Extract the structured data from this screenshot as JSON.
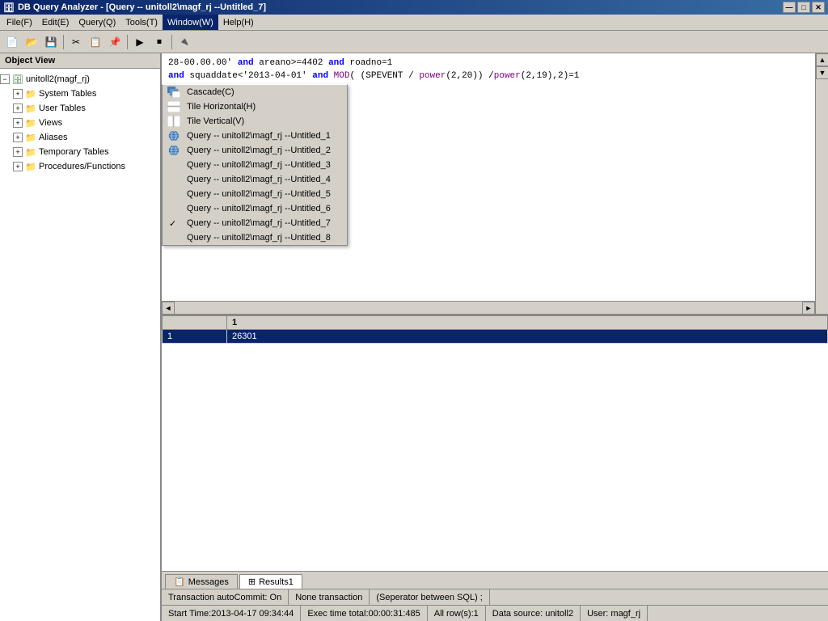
{
  "titleBar": {
    "title": "DB Query Analyzer - [Query -- unitoll2\\magf_rj --Untitled_7]",
    "dbIcon": "🗄",
    "controls": [
      "—",
      "□",
      "✕"
    ],
    "innerControls": [
      "—",
      "□",
      "✕"
    ]
  },
  "menuBar": {
    "items": [
      {
        "label": "File(F)",
        "id": "file"
      },
      {
        "label": "Edit(E)",
        "id": "edit"
      },
      {
        "label": "Query(Q)",
        "id": "query"
      },
      {
        "label": "Tools(T)",
        "id": "tools"
      },
      {
        "label": "Window(W)",
        "id": "window",
        "active": true
      },
      {
        "label": "Help(H)",
        "id": "help"
      }
    ]
  },
  "windowMenu": {
    "items": [
      {
        "label": "Cascade(C)",
        "hasIcon": true,
        "iconType": "cascade"
      },
      {
        "label": "Tile Horizontal(H)",
        "hasIcon": true,
        "iconType": "tile-h"
      },
      {
        "label": "Tile Vertical(V)",
        "hasIcon": true,
        "iconType": "tile-v"
      },
      {
        "label": "Query -- unitoll2\\magf_rj --Untitled_1",
        "hasIcon": true,
        "iconType": "globe"
      },
      {
        "label": "Query -- unitoll2\\magf_rj --Untitled_2",
        "hasIcon": true,
        "iconType": "globe"
      },
      {
        "label": "Query -- unitoll2\\magf_rj --Untitled_3",
        "hasIcon": false
      },
      {
        "label": "Query -- unitoll2\\magf_rj --Untitled_4",
        "hasIcon": false
      },
      {
        "label": "Query -- unitoll2\\magf_rj --Untitled_5",
        "hasIcon": false
      },
      {
        "label": "Query -- unitoll2\\magf_rj --Untitled_6",
        "hasIcon": false
      },
      {
        "label": "Query -- unitoll2\\magf_rj --Untitled_7",
        "hasIcon": false,
        "checked": true
      },
      {
        "label": "Query -- unitoll2\\magf_rj --Untitled_8",
        "hasIcon": false
      }
    ]
  },
  "objectView": {
    "header": "Object View",
    "tree": [
      {
        "level": 0,
        "label": "unitoll2(magf_rj)",
        "icon": "db",
        "expanded": true,
        "toggle": "-"
      },
      {
        "level": 1,
        "label": "System Tables",
        "icon": "folder",
        "expanded": false,
        "toggle": "+"
      },
      {
        "level": 1,
        "label": "User Tables",
        "icon": "folder",
        "expanded": false,
        "toggle": "+"
      },
      {
        "level": 1,
        "label": "Views",
        "icon": "folder",
        "expanded": false,
        "toggle": "+"
      },
      {
        "level": 1,
        "label": "Aliases",
        "icon": "folder",
        "expanded": false,
        "toggle": "+"
      },
      {
        "level": 1,
        "label": "Temporary Tables",
        "icon": "folder",
        "expanded": false,
        "toggle": "+"
      },
      {
        "level": 1,
        "label": "Procedures/Functions",
        "icon": "folder",
        "expanded": false,
        "toggle": "+"
      }
    ]
  },
  "sqlEditor": {
    "line1": "28-00.00.00' and areano>=4402 and roadno=1",
    "line2": "and squaddate<'2013-04-01' and MOD( (SPEVENT / power(2,20)) /power(2,19),2)=1"
  },
  "results": {
    "columns": [
      "1"
    ],
    "rows": [
      {
        "col1": "1",
        "col2": "26301",
        "selected": true
      }
    ]
  },
  "tabs": [
    {
      "label": "Messages",
      "icon": "msg",
      "active": false
    },
    {
      "label": "Results1",
      "icon": "grid",
      "active": true
    }
  ],
  "statusBar1": {
    "cells": [
      "Transaction autoCommit: On",
      "None transaction",
      "(Seperator between SQL)  ;"
    ]
  },
  "statusBar2": {
    "cells": [
      "Start Time:2013-04-17 09:34:44",
      "Exec time total:00:00:31:485",
      "All row(s):1",
      "Data source: unitoll2",
      "User: magf_rj"
    ]
  },
  "colors": {
    "titleBg": "#0a246a",
    "selected": "#0a246a",
    "menuBg": "#d4d0c8"
  }
}
